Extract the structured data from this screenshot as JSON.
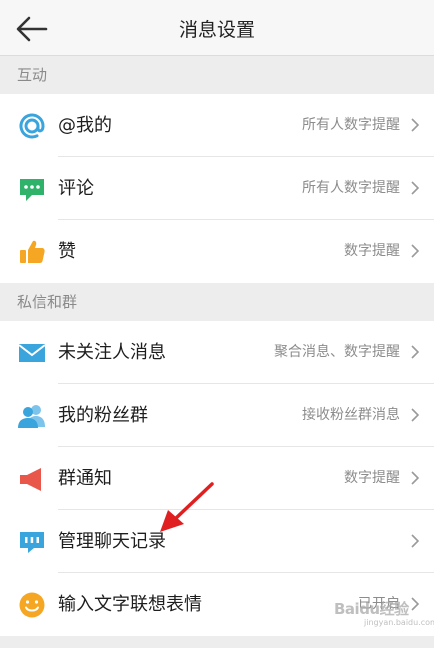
{
  "header": {
    "title": "消息设置"
  },
  "sections": [
    {
      "label": "互动",
      "items": [
        {
          "label": "@我的",
          "value": "所有人数字提醒",
          "icon": "at-icon"
        },
        {
          "label": "评论",
          "value": "所有人数字提醒",
          "icon": "comment-icon"
        },
        {
          "label": "赞",
          "value": "数字提醒",
          "icon": "thumbs-up-icon"
        }
      ]
    },
    {
      "label": "私信和群",
      "items": [
        {
          "label": "未关注人消息",
          "value": "聚合消息、数字提醒",
          "icon": "mail-icon"
        },
        {
          "label": "我的粉丝群",
          "value": "接收粉丝群消息",
          "icon": "group-icon"
        },
        {
          "label": "群通知",
          "value": "数字提醒",
          "icon": "megaphone-icon"
        },
        {
          "label": "管理聊天记录",
          "value": "",
          "icon": "chat-history-icon"
        },
        {
          "label": "输入文字联想表情",
          "value": "已开启",
          "icon": "smiley-icon"
        }
      ]
    }
  ],
  "colors": {
    "accent_green": "#4cc26a",
    "icon_blue": "#3aa4dc",
    "icon_green": "#2fb36b",
    "icon_orange": "#f5a623",
    "icon_red": "#e8574a",
    "arrow_red": "#e02020"
  },
  "watermark": {
    "text": "Baidu经验",
    "sub": "jingyan.baidu.com"
  }
}
